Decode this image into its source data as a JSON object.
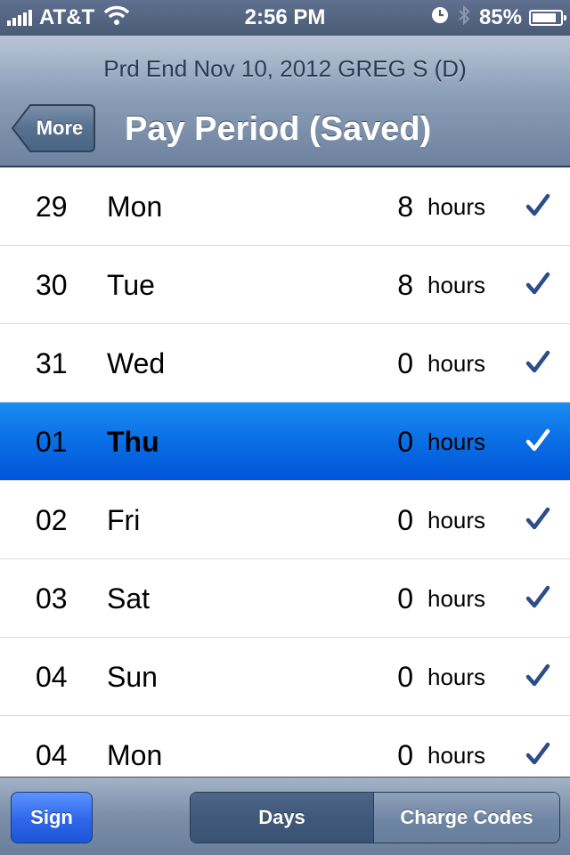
{
  "status_bar": {
    "carrier": "AT&T",
    "time": "2:56 PM",
    "battery_percent": "85%",
    "battery_level": 0.85,
    "icons": [
      "signal-icon",
      "wifi-icon",
      "clock-icon",
      "bluetooth-icon",
      "battery-icon"
    ]
  },
  "nav": {
    "prompt": "Prd End Nov 10, 2012 GREG S (D)",
    "back_label": "More",
    "title": "Pay Period (Saved)"
  },
  "rows": [
    {
      "date": "29",
      "day": "Mon",
      "hours": "8",
      "unit": "hours",
      "checked": true,
      "selected": false
    },
    {
      "date": "30",
      "day": "Tue",
      "hours": "8",
      "unit": "hours",
      "checked": true,
      "selected": false
    },
    {
      "date": "31",
      "day": "Wed",
      "hours": "0",
      "unit": "hours",
      "checked": true,
      "selected": false
    },
    {
      "date": "01",
      "day": "Thu",
      "hours": "0",
      "unit": "hours",
      "checked": true,
      "selected": true
    },
    {
      "date": "02",
      "day": "Fri",
      "hours": "0",
      "unit": "hours",
      "checked": true,
      "selected": false
    },
    {
      "date": "03",
      "day": "Sat",
      "hours": "0",
      "unit": "hours",
      "checked": true,
      "selected": false
    },
    {
      "date": "04",
      "day": "Sun",
      "hours": "0",
      "unit": "hours",
      "checked": true,
      "selected": false
    },
    {
      "date": "04",
      "day": "Mon",
      "hours": "0",
      "unit": "hours",
      "checked": true,
      "selected": false
    }
  ],
  "toolbar": {
    "sign_label": "Sign",
    "segments": [
      {
        "label": "Days",
        "active": true
      },
      {
        "label": "Charge Codes",
        "active": false
      }
    ]
  },
  "colors": {
    "checkmark": "#2c4d8a",
    "checkmark_selected": "#ffffff",
    "selection": "#0a6ee4"
  }
}
